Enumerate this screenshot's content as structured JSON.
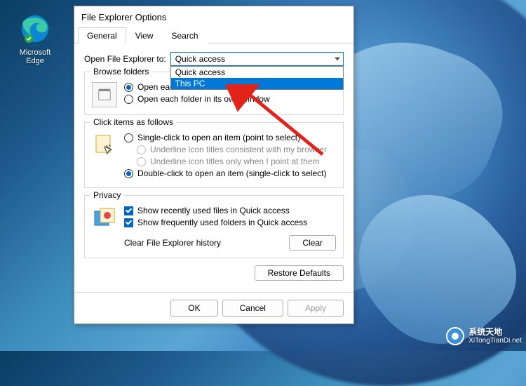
{
  "desktop": {
    "edge_label": "Microsoft\nEdge"
  },
  "dialog": {
    "title": "File Explorer Options",
    "tabs": {
      "general": "General",
      "view": "View",
      "search": "Search"
    },
    "open_label": "Open File Explorer to:",
    "combo_value": "Quick access",
    "dropdown": {
      "opt1": "Quick access",
      "opt2": "This PC"
    },
    "browse": {
      "title": "Browse folders",
      "same": "Open each folder in the same window",
      "own": "Open each folder in its own window"
    },
    "click": {
      "title": "Click items as follows",
      "single": "Single-click to open an item (point to select)",
      "underline_browser": "Underline icon titles consistent with my browser",
      "underline_point": "Underline icon titles only when I point at them",
      "double": "Double-click to open an item (single-click to select)"
    },
    "privacy": {
      "title": "Privacy",
      "recent": "Show recently used files in Quick access",
      "frequent": "Show frequently used folders in Quick access",
      "clear_label": "Clear File Explorer history",
      "clear_btn": "Clear"
    },
    "restore": "Restore Defaults",
    "ok": "OK",
    "cancel": "Cancel",
    "apply": "Apply"
  },
  "watermark": {
    "line1": "系统天地",
    "line2": "XiTongTianDi.net"
  }
}
